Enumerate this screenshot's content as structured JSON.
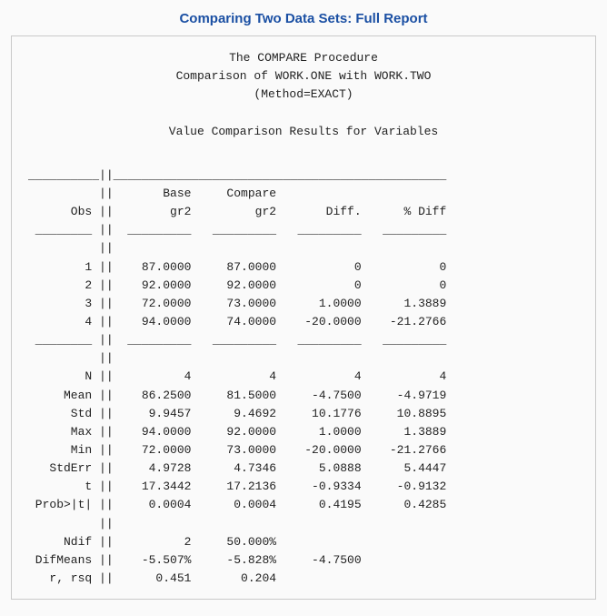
{
  "title": "Comparing Two Data Sets: Full Report",
  "hdr": {
    "l1": "The COMPARE Procedure",
    "l2": "Comparison of WORK.ONE with WORK.TWO",
    "l3": "(Method=EXACT)",
    "l4": "Value Comparison Results for Variables"
  },
  "th": {
    "base": "Base",
    "compare": "Compare",
    "obs": "Obs",
    "gr2a": "gr2",
    "gr2b": "gr2",
    "diff": "Diff.",
    "pdiff": "% Diff"
  },
  "obs": {
    "r1": {
      "n": "1",
      "base": "87.0000",
      "compare": "87.0000",
      "diff": "0",
      "pdiff": "0"
    },
    "r2": {
      "n": "2",
      "base": "92.0000",
      "compare": "92.0000",
      "diff": "0",
      "pdiff": "0"
    },
    "r3": {
      "n": "3",
      "base": "72.0000",
      "compare": "73.0000",
      "diff": "1.0000",
      "pdiff": "1.3889"
    },
    "r4": {
      "n": "4",
      "base": "94.0000",
      "compare": "74.0000",
      "diff": "-20.0000",
      "pdiff": "-21.2766"
    }
  },
  "stat": {
    "N": {
      "lbl": "N",
      "base": "4",
      "compare": "4",
      "diff": "4",
      "pdiff": "4"
    },
    "Mean": {
      "lbl": "Mean",
      "base": "86.2500",
      "compare": "81.5000",
      "diff": "-4.7500",
      "pdiff": "-4.9719"
    },
    "Std": {
      "lbl": "Std",
      "base": "9.9457",
      "compare": "9.4692",
      "diff": "10.1776",
      "pdiff": "10.8895"
    },
    "Max": {
      "lbl": "Max",
      "base": "94.0000",
      "compare": "92.0000",
      "diff": "1.0000",
      "pdiff": "1.3889"
    },
    "Min": {
      "lbl": "Min",
      "base": "72.0000",
      "compare": "73.0000",
      "diff": "-20.0000",
      "pdiff": "-21.2766"
    },
    "StdErr": {
      "lbl": "StdErr",
      "base": "4.9728",
      "compare": "4.7346",
      "diff": "5.0888",
      "pdiff": "5.4447"
    },
    "t": {
      "lbl": "t",
      "base": "17.3442",
      "compare": "17.2136",
      "diff": "-0.9334",
      "pdiff": "-0.9132"
    },
    "Probt": {
      "lbl": "Prob>|t|",
      "base": "0.0004",
      "compare": "0.0004",
      "diff": "0.4195",
      "pdiff": "0.4285"
    }
  },
  "extra": {
    "Ndif": {
      "lbl": "Ndif",
      "base": "2",
      "compare": "50.000%"
    },
    "DifMeans": {
      "lbl": "DifMeans",
      "base": "-5.507%",
      "compare": "-5.828%",
      "diff": "-4.7500"
    },
    "rrsq": {
      "lbl": "r, rsq",
      "base": "0.451",
      "compare": "0.204"
    }
  }
}
